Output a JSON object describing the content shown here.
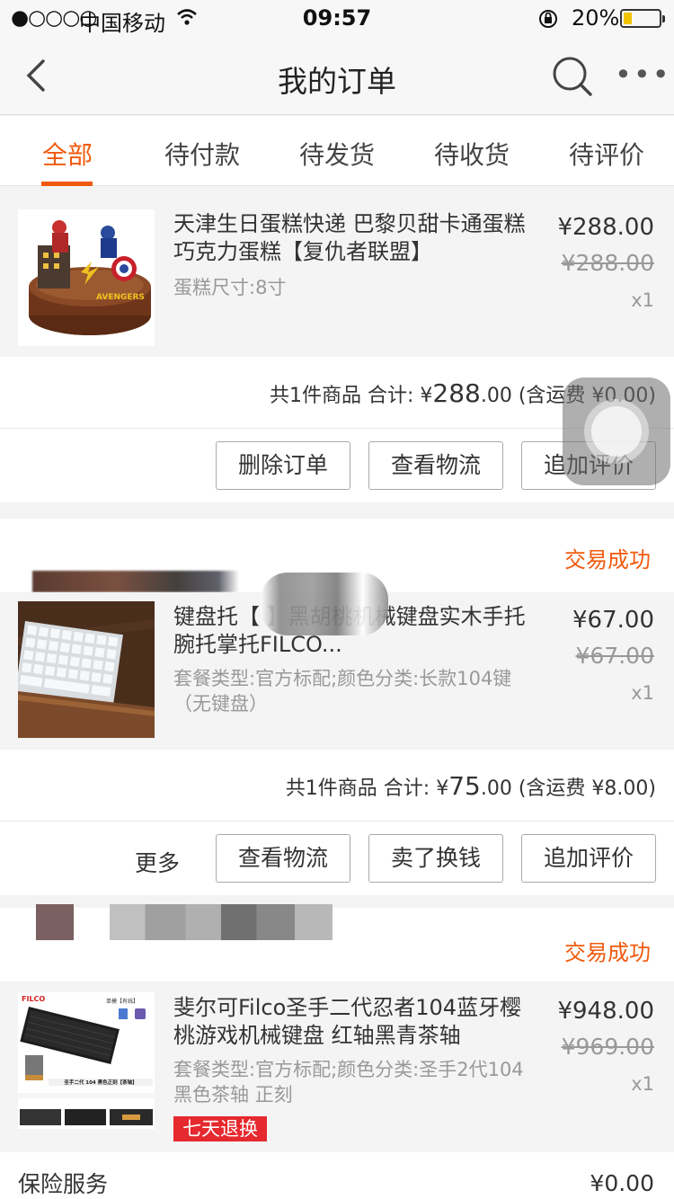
{
  "status_bar": {
    "signal": "●○○○○",
    "carrier": "中国移动",
    "time": "09:57",
    "battery": "20%"
  },
  "nav": {
    "title": "我的订单"
  },
  "tabs": [
    {
      "label": "全部"
    },
    {
      "label": "待付款"
    },
    {
      "label": "待发货"
    },
    {
      "label": "待收货"
    },
    {
      "label": "待评价"
    }
  ],
  "orders": [
    {
      "product": {
        "title": "天津生日蛋糕快递 巴黎贝甜卡通蛋糕巧克力蛋糕【复仇者联盟】",
        "spec": "蛋糕尺寸:8寸",
        "price": "¥288.00",
        "original_price": "¥288.00",
        "qty": "x1",
        "image_text": "AVENGERS"
      },
      "summary": {
        "prefix": "共1件商品 合计: ¥",
        "total_big": "288",
        "total_small": ".00",
        "shipping": "(含运费 ¥0.00)"
      },
      "actions": [
        "删除订单",
        "查看物流",
        "追加评价"
      ]
    },
    {
      "status": "交易成功",
      "product": {
        "title": "键盘托【 】黑胡桃机械键盘实木手托 腕托掌托FILCO...",
        "spec": "套餐类型:官方标配;颜色分类:长款104键（无键盘）",
        "price": "¥67.00",
        "original_price": "¥67.00",
        "qty": "x1"
      },
      "summary": {
        "prefix": "共1件商品 合计: ¥",
        "total_big": "75",
        "total_small": ".00",
        "shipping": "(含运费 ¥8.00)"
      },
      "more": "更多",
      "actions": [
        "查看物流",
        "卖了换钱",
        "追加评价"
      ]
    },
    {
      "status": "交易成功",
      "product": {
        "title": "斐尔可Filco圣手二代忍者104蓝牙樱桃游戏机械键盘 红轴黑青茶轴",
        "spec": "套餐类型:官方标配;颜色分类:圣手2代104黑色茶轴 正刻",
        "price": "¥948.00",
        "original_price": "¥969.00",
        "qty": "x1",
        "badge": "七天退换",
        "image_brand": "FILCO",
        "image_tag": "单模【有线】",
        "image_caption": "圣手二代 104 黑色正刻【茶轴】"
      }
    }
  ],
  "insurance": {
    "label": "保险服务",
    "value": "¥0.00"
  },
  "colors": {
    "accent": "#f05a0e",
    "badge": "#e5292e"
  }
}
